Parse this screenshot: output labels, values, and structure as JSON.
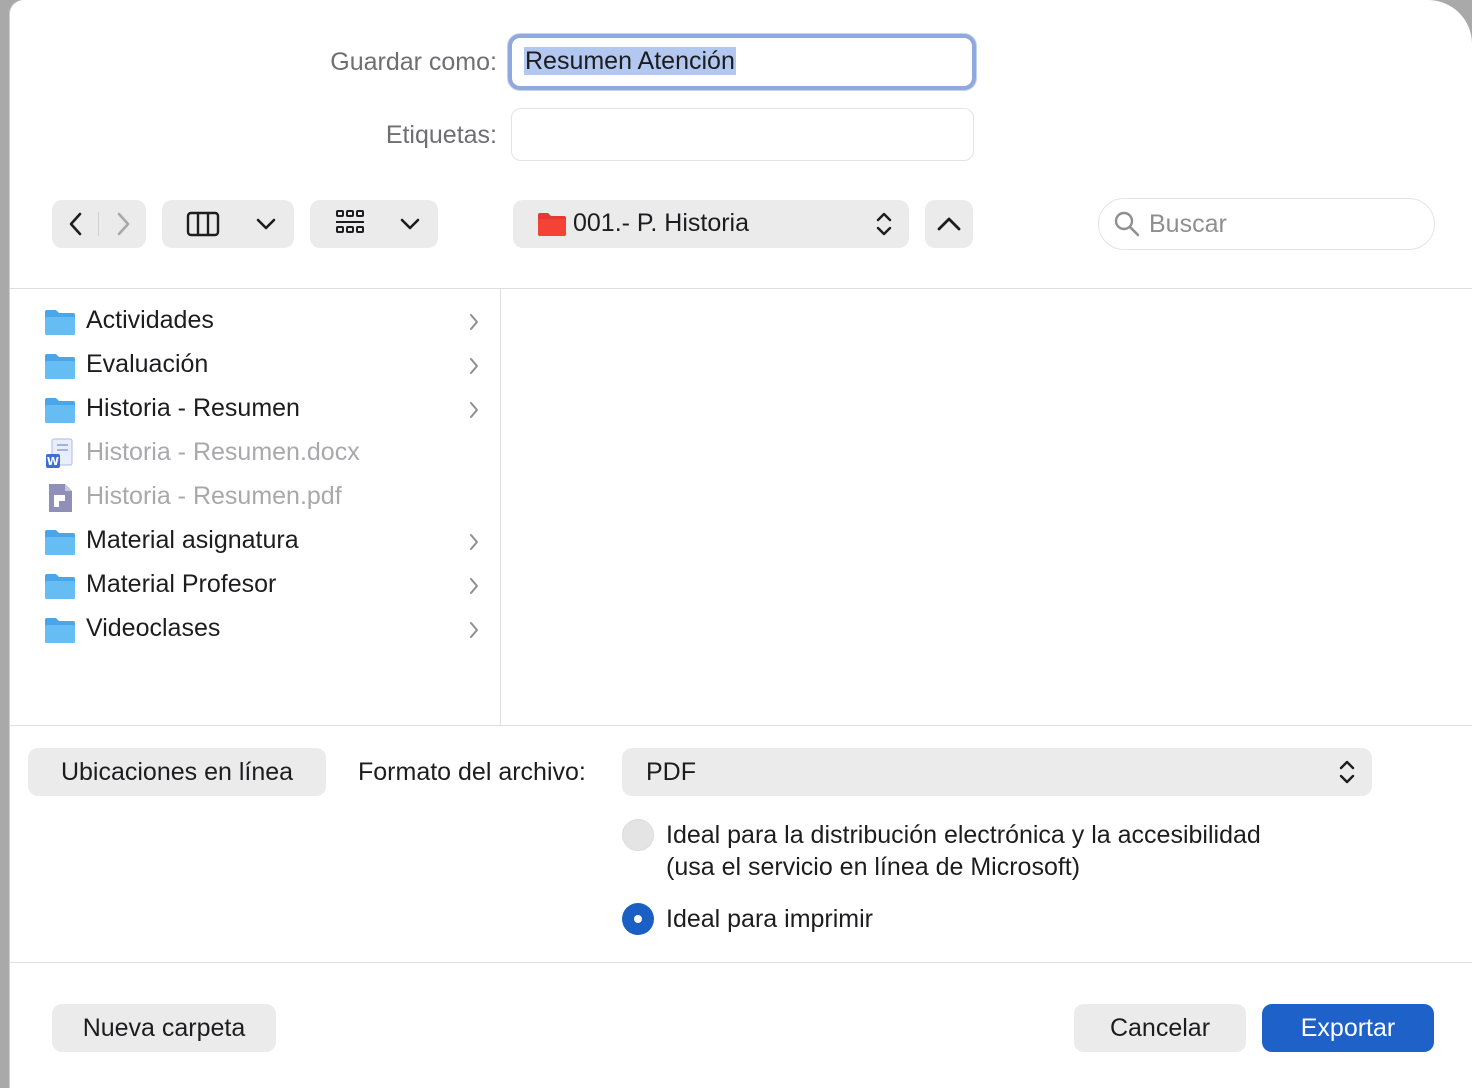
{
  "dialog": {
    "save_as_label": "Guardar como:",
    "save_as_value": "Resumen Atención",
    "tags_label": "Etiquetas:",
    "tags_value": ""
  },
  "toolbar": {
    "back_icon": "chevron-left-icon",
    "forward_icon": "chevron-right-icon",
    "view_columns_icon": "columns-view-icon",
    "view_grid_icon": "grid-view-icon",
    "location": "001.- P. Historia",
    "location_folder_color": "#e53935",
    "search_placeholder": "Buscar"
  },
  "files": [
    {
      "name": "Actividades",
      "kind": "folder",
      "enabled": true
    },
    {
      "name": "Evaluación",
      "kind": "folder",
      "enabled": true
    },
    {
      "name": "Historia - Resumen",
      "kind": "folder",
      "enabled": true
    },
    {
      "name": "Historia - Resumen.docx",
      "kind": "docx",
      "enabled": false
    },
    {
      "name": "Historia - Resumen.pdf",
      "kind": "pdf",
      "enabled": false
    },
    {
      "name": "Material asignatura",
      "kind": "folder",
      "enabled": true
    },
    {
      "name": "Material Profesor",
      "kind": "folder",
      "enabled": true
    },
    {
      "name": "Videoclases",
      "kind": "folder",
      "enabled": true
    }
  ],
  "bottom": {
    "online_locations_label": "Ubicaciones en línea",
    "format_label": "Formato del archivo:",
    "format_value": "PDF",
    "option_electronic_line1": "Ideal para la distribución electrónica y la accesibilidad",
    "option_electronic_line2": "(usa el servicio en línea de Microsoft)",
    "option_print": "Ideal para imprimir",
    "selected_option": "print"
  },
  "footer": {
    "new_folder_label": "Nueva carpeta",
    "cancel_label": "Cancelar",
    "export_label": "Exportar"
  },
  "colors": {
    "accent": "#1e62c9",
    "folder_blue": "#5cb3ef"
  }
}
